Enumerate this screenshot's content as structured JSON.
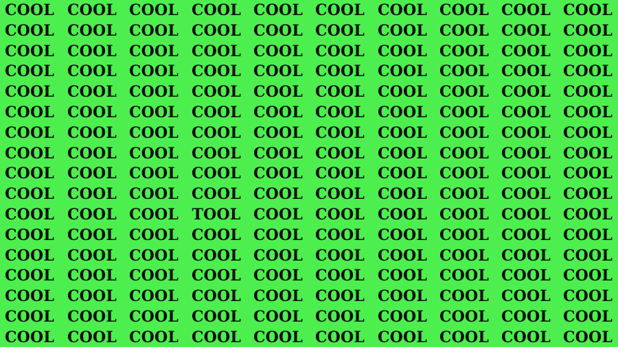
{
  "puzzle": {
    "background_color": "#4def4f",
    "text_color": "#0a0f06",
    "rows": 17,
    "cols": 10,
    "default_word": "COOL",
    "odd_word": "TOOL",
    "odd_position": {
      "row": 11,
      "col": 4
    },
    "grid": [
      [
        "COOL",
        "COOL",
        "COOL",
        "COOL",
        "COOL",
        "COOL",
        "COOL",
        "COOL",
        "COOL",
        "COOL"
      ],
      [
        "COOL",
        "COOL",
        "COOL",
        "COOL",
        "COOL",
        "COOL",
        "COOL",
        "COOL",
        "COOL",
        "COOL"
      ],
      [
        "COOL",
        "COOL",
        "COOL",
        "COOL",
        "COOL",
        "COOL",
        "COOL",
        "COOL",
        "COOL",
        "COOL"
      ],
      [
        "COOL",
        "COOL",
        "COOL",
        "COOL",
        "COOL",
        "COOL",
        "COOL",
        "COOL",
        "COOL",
        "COOL"
      ],
      [
        "COOL",
        "COOL",
        "COOL",
        "COOL",
        "COOL",
        "COOL",
        "COOL",
        "COOL",
        "COOL",
        "COOL"
      ],
      [
        "COOL",
        "COOL",
        "COOL",
        "COOL",
        "COOL",
        "COOL",
        "COOL",
        "COOL",
        "COOL",
        "COOL"
      ],
      [
        "COOL",
        "COOL",
        "COOL",
        "COOL",
        "COOL",
        "COOL",
        "COOL",
        "COOL",
        "COOL",
        "COOL"
      ],
      [
        "COOL",
        "COOL",
        "COOL",
        "COOL",
        "COOL",
        "COOL",
        "COOL",
        "COOL",
        "COOL",
        "COOL"
      ],
      [
        "COOL",
        "COOL",
        "COOL",
        "COOL",
        "COOL",
        "COOL",
        "COOL",
        "COOL",
        "COOL",
        "COOL"
      ],
      [
        "COOL",
        "COOL",
        "COOL",
        "COOL",
        "COOL",
        "COOL",
        "COOL",
        "COOL",
        "COOL",
        "COOL"
      ],
      [
        "COOL",
        "COOL",
        "COOL",
        "TOOL",
        "COOL",
        "COOL",
        "COOL",
        "COOL",
        "COOL",
        "COOL"
      ],
      [
        "COOL",
        "COOL",
        "COOL",
        "COOL",
        "COOL",
        "COOL",
        "COOL",
        "COOL",
        "COOL",
        "COOL"
      ],
      [
        "COOL",
        "COOL",
        "COOL",
        "COOL",
        "COOL",
        "COOL",
        "COOL",
        "COOL",
        "COOL",
        "COOL"
      ],
      [
        "COOL",
        "COOL",
        "COOL",
        "COOL",
        "COOL",
        "COOL",
        "COOL",
        "COOL",
        "COOL",
        "COOL"
      ],
      [
        "COOL",
        "COOL",
        "COOL",
        "COOL",
        "COOL",
        "COOL",
        "COOL",
        "COOL",
        "COOL",
        "COOL"
      ],
      [
        "COOL",
        "COOL",
        "COOL",
        "COOL",
        "COOL",
        "COOL",
        "COOL",
        "COOL",
        "COOL",
        "COOL"
      ],
      [
        "COOL",
        "COOL",
        "COOL",
        "COOL",
        "COOL",
        "COOL",
        "COOL",
        "COOL",
        "COOL",
        "COOL"
      ]
    ]
  }
}
